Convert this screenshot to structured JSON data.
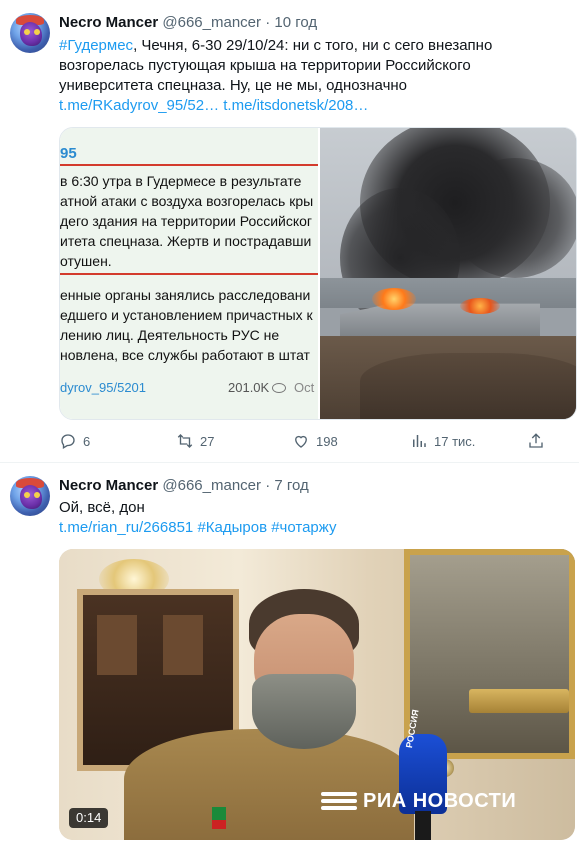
{
  "tweets": [
    {
      "author": {
        "name": "Necro Mancer",
        "handle": "@666_mancer",
        "separator": "·",
        "time": "10 год"
      },
      "text": {
        "hashtag": "#Гудермес",
        "body": ", Чечня, 6-30 29/10/24: ни с того, ни с сего внезапно возгорелась пустующая крыша на территории Российского университета спецназа. Ну, це не мы, однозначно",
        "link1": "t.me/RKadyrov_95/52…",
        "link2": "t.me/itsdonetsk/208…"
      },
      "media": {
        "telegram": {
          "channel": "95",
          "lines_a": [
            "в 6:30 утра в Гудермесе в результате",
            "атной атаки с воздуха возгорелась кры",
            "дего здания на территории Российског",
            "итета спецназа. Жертв и пострадавши",
            "отушен."
          ],
          "lines_b": [
            "енные органы занялись расследовани",
            "едшего и установлением причастных к",
            "лению лиц. Деятельность РУС не",
            "новлена, все службы работают в штат"
          ],
          "footer_link": "dyrov_95/5201",
          "views": "201.0K",
          "date": "Oct"
        }
      },
      "actions": {
        "replies": "6",
        "retweets": "27",
        "likes": "198",
        "views": "17 тис."
      }
    },
    {
      "author": {
        "name": "Necro Mancer",
        "handle": "@666_mancer",
        "separator": "·",
        "time": "7 год"
      },
      "text": {
        "line1": "Ой, всё, дон",
        "link": "t.me/rian_ru/266851",
        "hashtag1": "#Кадыров",
        "hashtag2": "#чотаржу"
      },
      "media": {
        "duration": "0:14",
        "watermark": "РИА НОВОСТИ",
        "mic_label": "РОССИЯ"
      }
    }
  ],
  "colors": {
    "link": "#1d9bf0",
    "muted": "#536471",
    "text": "#0f1419"
  }
}
